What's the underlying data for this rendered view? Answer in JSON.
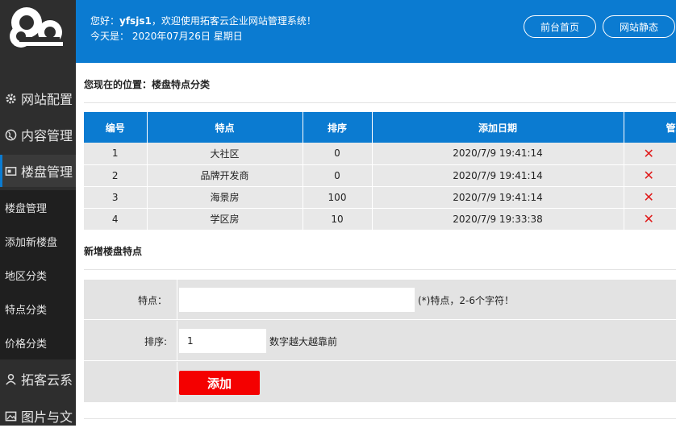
{
  "header": {
    "greeting_prefix": "您好：",
    "username": "yfsjs1",
    "greeting_suffix": "，欢迎使用拓客云企业网站管理系统！",
    "date_line": "今天是： 2020年07月26日 星期日",
    "buttons": [
      "前台首页",
      "网站静态"
    ]
  },
  "sidebar": {
    "main_items": [
      {
        "label": "网站配置",
        "icon": "gear-icon"
      },
      {
        "label": "内容管理",
        "icon": "globe-icon"
      },
      {
        "label": "楼盘管理",
        "icon": "card-icon"
      },
      {
        "label": "拓客云系",
        "icon": "user-icon"
      },
      {
        "label": "图片与文",
        "icon": "image-icon"
      }
    ],
    "sub_items": [
      "楼盘管理",
      "添加新楼盘",
      "地区分类",
      "特点分类",
      "价格分类"
    ]
  },
  "breadcrumb": "您现在的位置：楼盘特点分类",
  "table": {
    "headers": [
      "编号",
      "特点",
      "排序",
      "添加日期",
      "管理"
    ],
    "rows": [
      [
        "1",
        "大社区",
        "0",
        "2020/7/9 19:41:14"
      ],
      [
        "2",
        "品牌开发商",
        "0",
        "2020/7/9 19:41:14"
      ],
      [
        "3",
        "海景房",
        "100",
        "2020/7/9 19:41:14"
      ],
      [
        "4",
        "学区房",
        "10",
        "2020/7/9 19:33:38"
      ]
    ]
  },
  "form": {
    "title": "新增楼盘特点",
    "feature_label": "特点：",
    "feature_value": "",
    "feature_hint": "(*)特点，2-6个字符！",
    "order_label": "排序:",
    "order_value": "1",
    "order_hint": "数字越大越靠前",
    "submit_label": "添加"
  },
  "colors": {
    "accent": "#0b7bd1",
    "danger": "#f40000",
    "sidebar": "#2e2e2e"
  }
}
